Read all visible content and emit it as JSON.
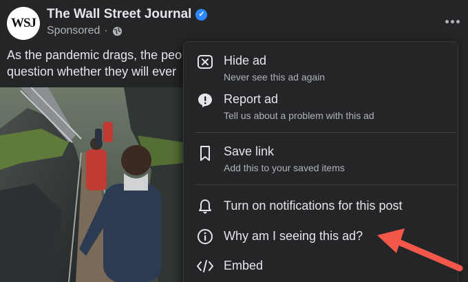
{
  "post": {
    "page_name": "The Wall Street Journal",
    "avatar_text": "WSJ",
    "sponsored_label": "Sponsored",
    "separator": "·",
    "text_line1": "As the pandemic drags, the peo",
    "text_line2": "question whether they will ever"
  },
  "menu": {
    "items": [
      {
        "label": "Hide ad",
        "desc": "Never see this ad again",
        "icon": "close-box-icon"
      },
      {
        "label": "Report ad",
        "desc": "Tell us about a problem with this ad",
        "icon": "alert-icon"
      },
      {
        "label": "Save link",
        "desc": "Add this to your saved items",
        "icon": "bookmark-icon"
      },
      {
        "label": "Turn on notifications for this post",
        "icon": "bell-icon"
      },
      {
        "label": "Why am I seeing this ad?",
        "icon": "info-icon"
      },
      {
        "label": "Embed",
        "icon": "code-icon"
      }
    ]
  },
  "colors": {
    "background": "#242526",
    "text_primary": "#e4e6eb",
    "text_secondary": "#b0b3b8",
    "verified_blue": "#2d88ff",
    "annotation_arrow": "#f2574a"
  }
}
